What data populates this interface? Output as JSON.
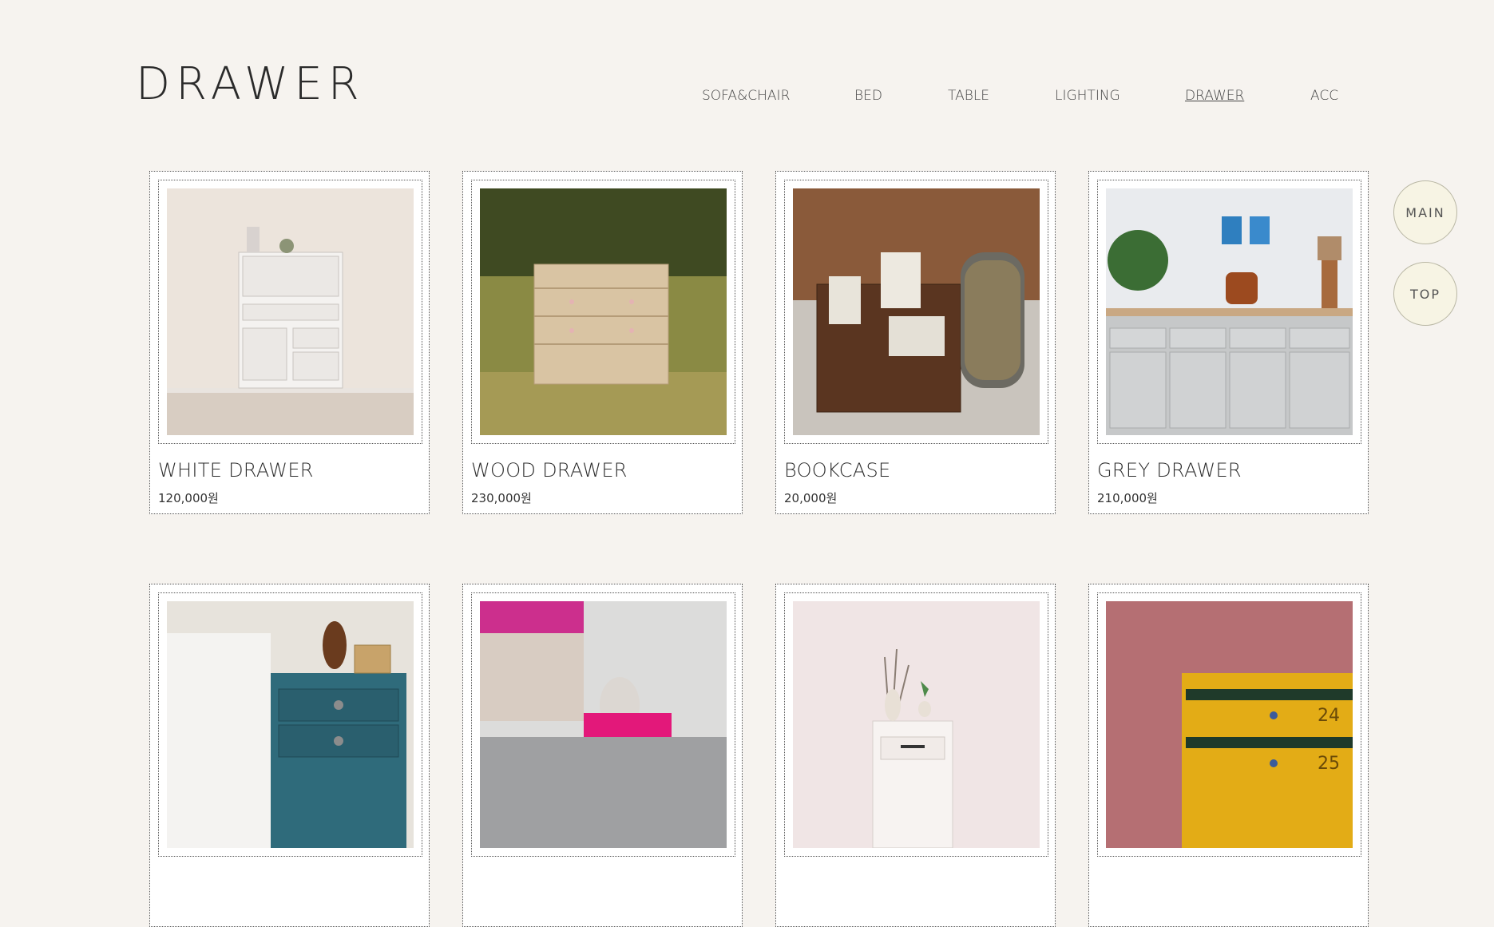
{
  "header": {
    "logo": "DRAWER"
  },
  "nav": [
    {
      "label": "SOFA&CHAIR",
      "active": false
    },
    {
      "label": "BED",
      "active": false
    },
    {
      "label": "TABLE",
      "active": false
    },
    {
      "label": "LIGHTING",
      "active": false
    },
    {
      "label": "DRAWER",
      "active": true
    },
    {
      "label": "ACC",
      "active": false
    }
  ],
  "products": [
    {
      "name": "WHITE DRAWER",
      "price": "120,000원",
      "image": "white-secretary-drawer"
    },
    {
      "name": "WOOD DRAWER",
      "price": "230,000원",
      "image": "wood-drawer-in-grass"
    },
    {
      "name": "BOOKCASE",
      "price": "20,000원",
      "image": "wooden-bookcase-crate"
    },
    {
      "name": "GREY DRAWER",
      "price": "210,000원",
      "image": "grey-sideboard"
    },
    {
      "name": "",
      "price": "",
      "image": "teal-nightstand"
    },
    {
      "name": "",
      "price": "",
      "image": "grey-cabinet-buddha"
    },
    {
      "name": "",
      "price": "",
      "image": "white-small-drawer"
    },
    {
      "name": "",
      "price": "",
      "image": "yellow-mailbox-drawer"
    }
  ],
  "side_buttons": {
    "main": "MAIN",
    "top": "TOP"
  },
  "colors": {
    "background": "#f6f3ef",
    "button_bg": "#f7f4e4",
    "text": "#333333"
  }
}
